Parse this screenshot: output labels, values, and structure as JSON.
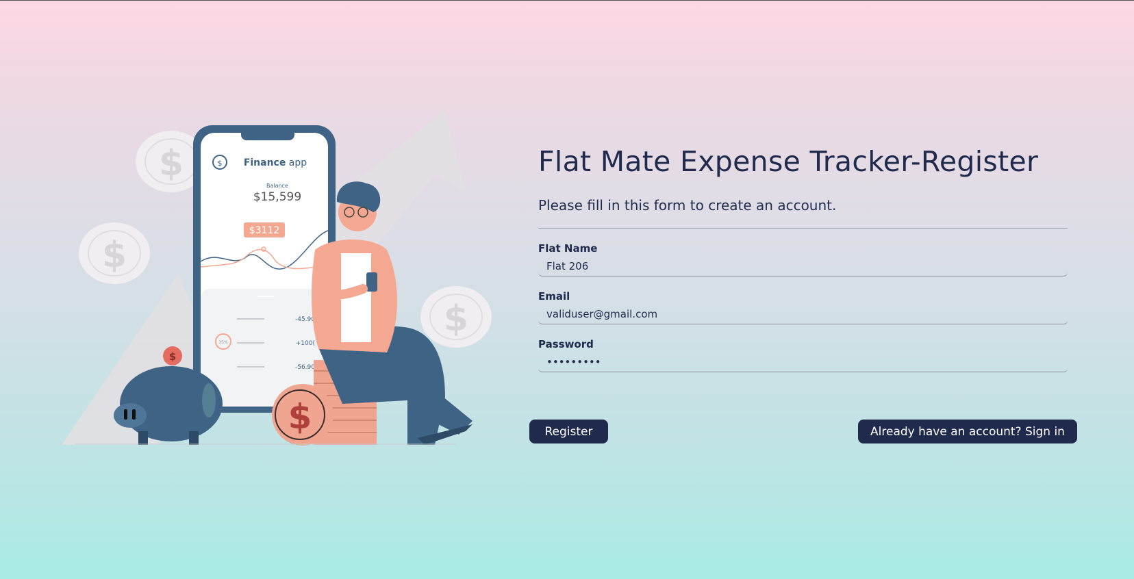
{
  "form": {
    "title": "Flat Mate Expense Tracker-Register",
    "subtitle": "Please fill in this form to create an account.",
    "fields": [
      {
        "label": "Flat Name",
        "value": "Flat 206",
        "type": "text"
      },
      {
        "label": "Email",
        "value": "validuser@gmail.com",
        "type": "email"
      },
      {
        "label": "Password",
        "value": "validpass",
        "type": "password"
      }
    ],
    "register_label": "Register",
    "signin_label": "Already have an account? Sign in"
  },
  "illustration": {
    "app_title_bold": "Finance",
    "app_title_rest": " app",
    "balance_label": "Balance",
    "balance_value": "$15,599",
    "highlight_value": "$3112",
    "transactions": [
      "-45.90",
      "+100(",
      "-56.90"
    ],
    "progress_label": "35%",
    "icons": [
      "dollar-icon",
      "more-vert-icon",
      "piggy-bank-icon",
      "dollar-coin-icon"
    ]
  }
}
